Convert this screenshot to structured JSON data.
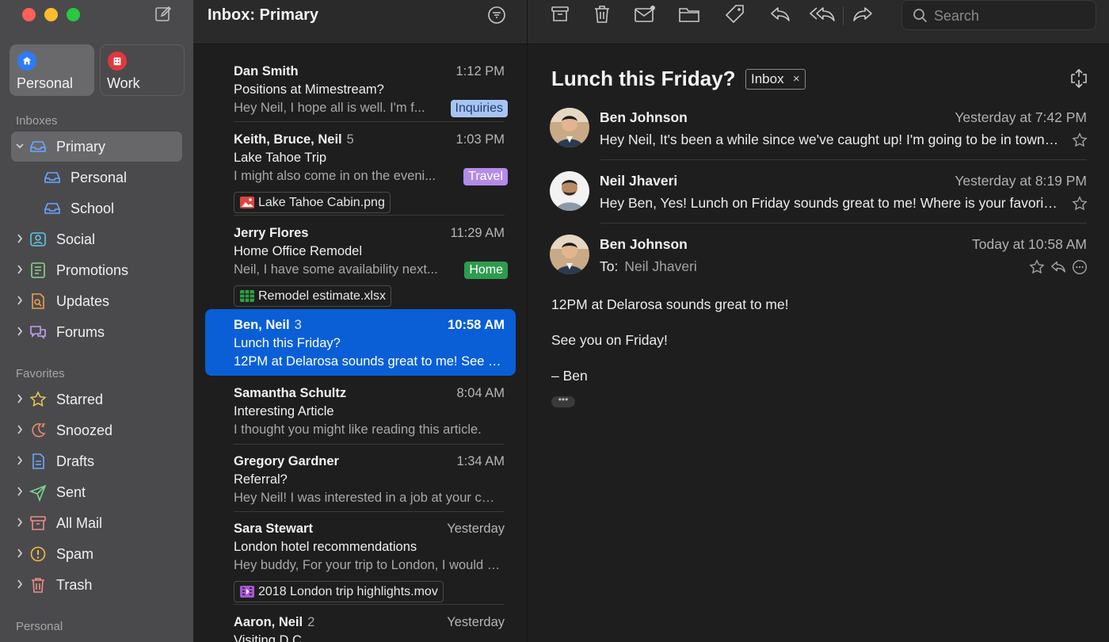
{
  "sidebar": {
    "accounts": [
      {
        "label": "Personal",
        "icon": "home-icon",
        "color": "#2d7cf6"
      },
      {
        "label": "Work",
        "icon": "building-icon",
        "color": "#e0383e"
      }
    ],
    "sections": {
      "inboxes": "Inboxes",
      "favorites": "Favorites",
      "personal": "Personal"
    },
    "inboxes": [
      {
        "label": "Primary",
        "icon": "inbox-tray-icon"
      },
      {
        "label": "Personal",
        "icon": "inbox-tray-icon"
      },
      {
        "label": "School",
        "icon": "inbox-tray-icon"
      },
      {
        "label": "Social",
        "icon": "people-icon"
      },
      {
        "label": "Promotions",
        "icon": "tag-list-icon"
      },
      {
        "label": "Updates",
        "icon": "document-search-icon"
      },
      {
        "label": "Forums",
        "icon": "chat-bubbles-icon"
      }
    ],
    "favorites": [
      {
        "label": "Starred",
        "icon": "star-icon"
      },
      {
        "label": "Snoozed",
        "icon": "moon-icon"
      },
      {
        "label": "Drafts",
        "icon": "document-icon"
      },
      {
        "label": "Sent",
        "icon": "paper-plane-icon"
      },
      {
        "label": "All Mail",
        "icon": "archive-icon"
      },
      {
        "label": "Spam",
        "icon": "warning-icon"
      },
      {
        "label": "Trash",
        "icon": "trash-icon"
      }
    ]
  },
  "list": {
    "title": "Inbox: Primary",
    "messages": [
      {
        "from": "Dan Smith",
        "count": "",
        "time": "1:12 PM",
        "subject": "Positions at Mimestream?",
        "preview": "Hey Neil, I hope all is well. I'm f...",
        "tag": "Inquiries"
      },
      {
        "from": "Keith, Bruce, Neil",
        "count": "5",
        "time": "1:03 PM",
        "subject": "Lake Tahoe Trip",
        "preview": "I might also come in on the eveni...",
        "tag": "Travel",
        "attachment": "Lake Tahoe Cabin.png"
      },
      {
        "from": "Jerry Flores",
        "count": "",
        "time": "11:29 AM",
        "subject": "Home Office Remodel",
        "preview": "Neil, I have some availability next...",
        "tag": "Home",
        "attachment": "Remodel estimate.xlsx"
      },
      {
        "from": "Ben, Neil",
        "count": "3",
        "time": "10:58 AM",
        "subject": "Lunch this Friday?",
        "preview": "12PM at Delarosa sounds great to me! See you on Friday!"
      },
      {
        "from": "Samantha Schultz",
        "count": "",
        "time": "8:04 AM",
        "subject": "Interesting Article",
        "preview": "I thought you might like reading this article."
      },
      {
        "from": "Gregory Gardner",
        "count": "",
        "time": "1:34 AM",
        "subject": "Referral?",
        "preview": "Hey Neil! I was interested in a job at your company"
      },
      {
        "from": "Sara Stewart",
        "count": "",
        "time": "Yesterday",
        "subject": "London hotel recommendations",
        "preview": "Hey buddy, For your trip to London, I would recommend",
        "attachment": "2018 London trip highlights.mov"
      },
      {
        "from": "Aaron, Neil",
        "count": "2",
        "time": "Yesterday",
        "subject": "Visiting D.C."
      }
    ]
  },
  "tags": {
    "Inquiries": {
      "bg": "#a9c4f2",
      "fg": "#1b3d73"
    },
    "Travel": {
      "bg": "#b48be6",
      "fg": "#ffffff"
    },
    "Home": {
      "bg": "#2e9b4e",
      "fg": "#ffffff"
    }
  },
  "pane": {
    "search_placeholder": "Search",
    "subject": "Lunch this Friday?",
    "label": "Inbox",
    "label_close": "×",
    "thread": [
      {
        "name": "Ben Johnson",
        "when": "Yesterday at 7:42 PM",
        "snippet": "Hey Neil, It's been a while since we've caught up! I'm going to be in town this week"
      },
      {
        "name": "Neil Jhaveri",
        "when": "Yesterday at 8:19 PM",
        "snippet": "Hey Ben, Yes! Lunch on Friday sounds great to me! Where is your favorite spot?"
      },
      {
        "name": "Ben Johnson",
        "when": "Today at 10:58 AM",
        "to_label": "To:",
        "to_value": "Neil Jhaveri"
      }
    ],
    "body": [
      "12PM at Delarosa sounds great to me!",
      "See you on Friday!",
      "– Ben"
    ],
    "more": "•••"
  }
}
